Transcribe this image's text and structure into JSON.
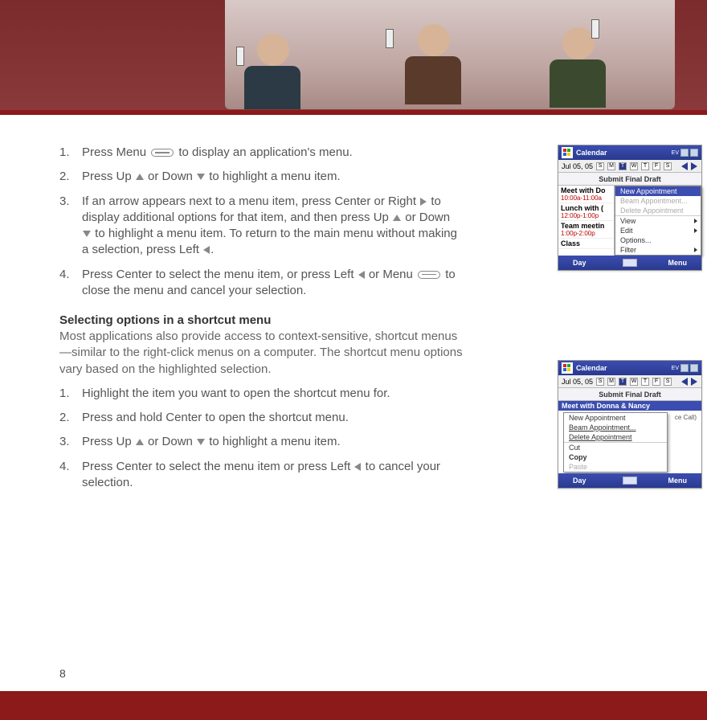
{
  "page_number": "8",
  "steps_a": {
    "s1": {
      "a": "Press Menu ",
      "b": " to display an application's menu."
    },
    "s2": {
      "a": "Press Up ",
      "b": " or Down ",
      "c": " to highlight a menu item."
    },
    "s3": {
      "a": "If an arrow appears next to a menu item, press Center or Right ",
      "b": " to display additional options for that item, and then press Up ",
      "c": " or Down ",
      "d": " to highlight a menu item. To return to the main menu without making a selection, press Left ",
      "e": "."
    },
    "s4": {
      "a": "Press Center to select the menu item, or press Left ",
      "b": " or Menu ",
      "c": " to close the menu and cancel your selection."
    }
  },
  "section_heading": "Selecting options in a shortcut menu",
  "intro": "Most applications also provide access to context-sensitive, shortcut menus—similar to the right-click menus on a computer. The shortcut menu options vary based on the highlighted selection.",
  "steps_b": {
    "s1": "Highlight the item you want to open the shortcut menu for.",
    "s2": "Press and hold Center to open the shortcut menu.",
    "s3": {
      "a": "Press Up ",
      "b": " or Down ",
      "c": " to highlight a menu item."
    },
    "s4": {
      "a": "Press Center to select the menu item or press Left ",
      "b": " to cancel your selection."
    }
  },
  "screenshot1": {
    "app_title": "Calendar",
    "status_battery": "EV",
    "date_label": "Jul 05, 05",
    "weekdays": [
      "S",
      "M",
      "T",
      "W",
      "T",
      "F",
      "S"
    ],
    "submit_label": "Submit Final Draft",
    "rows": [
      {
        "title": "Meet with Do",
        "time": "10:00a-11:00a"
      },
      {
        "title": "Lunch with (",
        "time": "12:00p-1:00p"
      },
      {
        "title": "Team meetin",
        "time": "1:00p-2:00p"
      },
      {
        "title": "Class",
        "time": ""
      }
    ],
    "menu": {
      "highlight": "New Appointment",
      "items_gray": [
        "Beam Appointment...",
        "Delete Appointment"
      ],
      "items_sub": [
        "View",
        "Edit",
        "Options...",
        "Filter"
      ]
    },
    "softkeys": {
      "left": "Day",
      "right": "Menu"
    }
  },
  "screenshot2": {
    "app_title": "Calendar",
    "status_battery": "EV",
    "date_label": "Jul 05, 05",
    "weekdays": [
      "S",
      "M",
      "T",
      "W",
      "T",
      "F",
      "S"
    ],
    "submit_label": "Submit Final Draft",
    "selected_row": "Meet with Donna & Nancy",
    "selected_row_sub": "ce Call)",
    "menu": {
      "items": [
        "New Appointment",
        "Beam Appointment...",
        "Delete Appointment"
      ],
      "items2": [
        "Cut",
        "Copy"
      ],
      "items_gray": [
        "Paste"
      ]
    },
    "softkeys": {
      "left": "Day",
      "right": "Menu"
    }
  }
}
